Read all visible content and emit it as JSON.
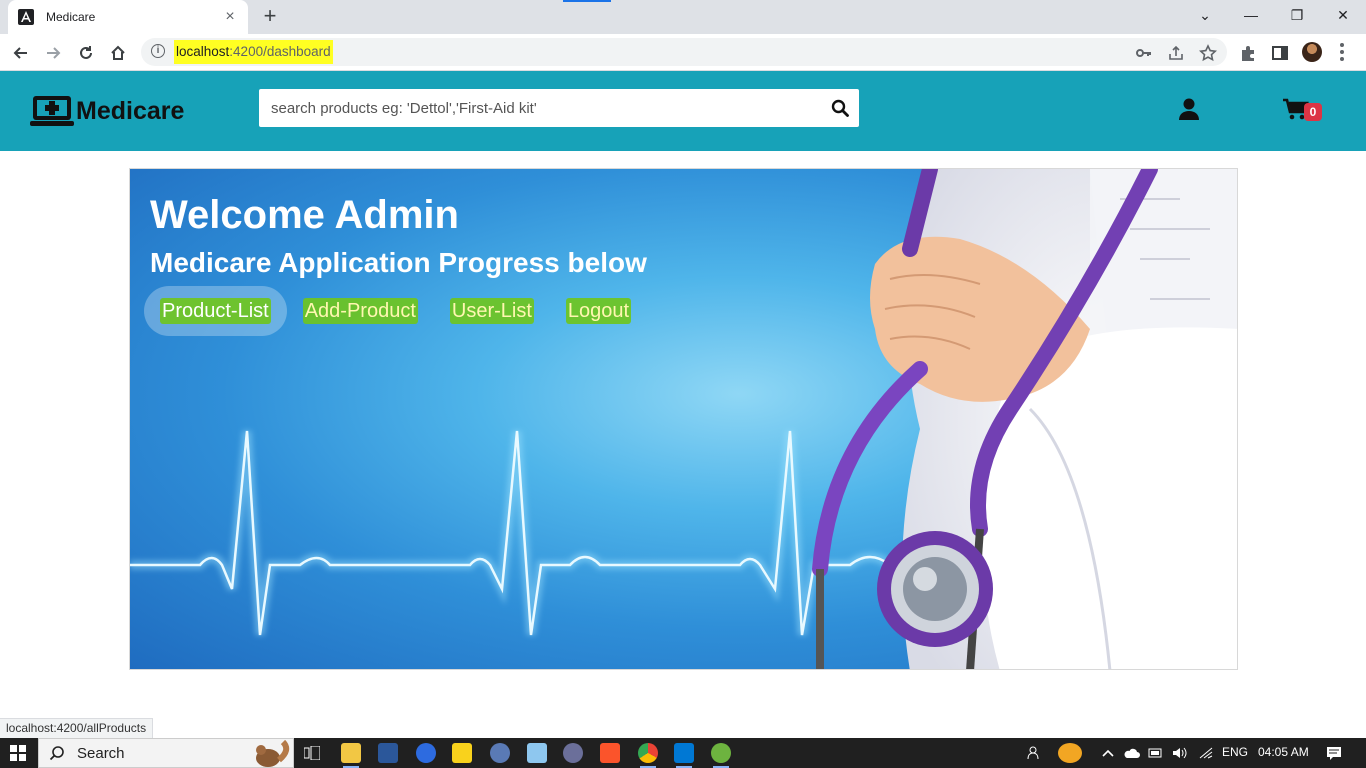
{
  "browser": {
    "tab_title": "Medicare",
    "tab_close": "×",
    "new_tab": "+",
    "url_host": "localhost",
    "url_rest": ":4200/dashboard",
    "window_controls": {
      "dropdown": "⌄",
      "minimize": "—",
      "restore": "❐",
      "close": "✕"
    }
  },
  "header": {
    "brand": "Medicare",
    "search_placeholder": "search products eg: 'Dettol','First-Aid kit'",
    "cart_count": "0",
    "accent_color": "#17a2b8"
  },
  "hero": {
    "title": "Welcome Admin",
    "subtitle": "Medicare Application Progress below",
    "nav": [
      {
        "label": "Product-List",
        "active": true
      },
      {
        "label": "Add-Product",
        "active": false
      },
      {
        "label": "User-List",
        "active": false
      },
      {
        "label": "Logout",
        "active": false
      }
    ]
  },
  "status_bar": {
    "url": "localhost:4200/allProducts"
  },
  "taskbar": {
    "search_label": "Search",
    "language": "ENG",
    "time": "04:05 AM"
  }
}
